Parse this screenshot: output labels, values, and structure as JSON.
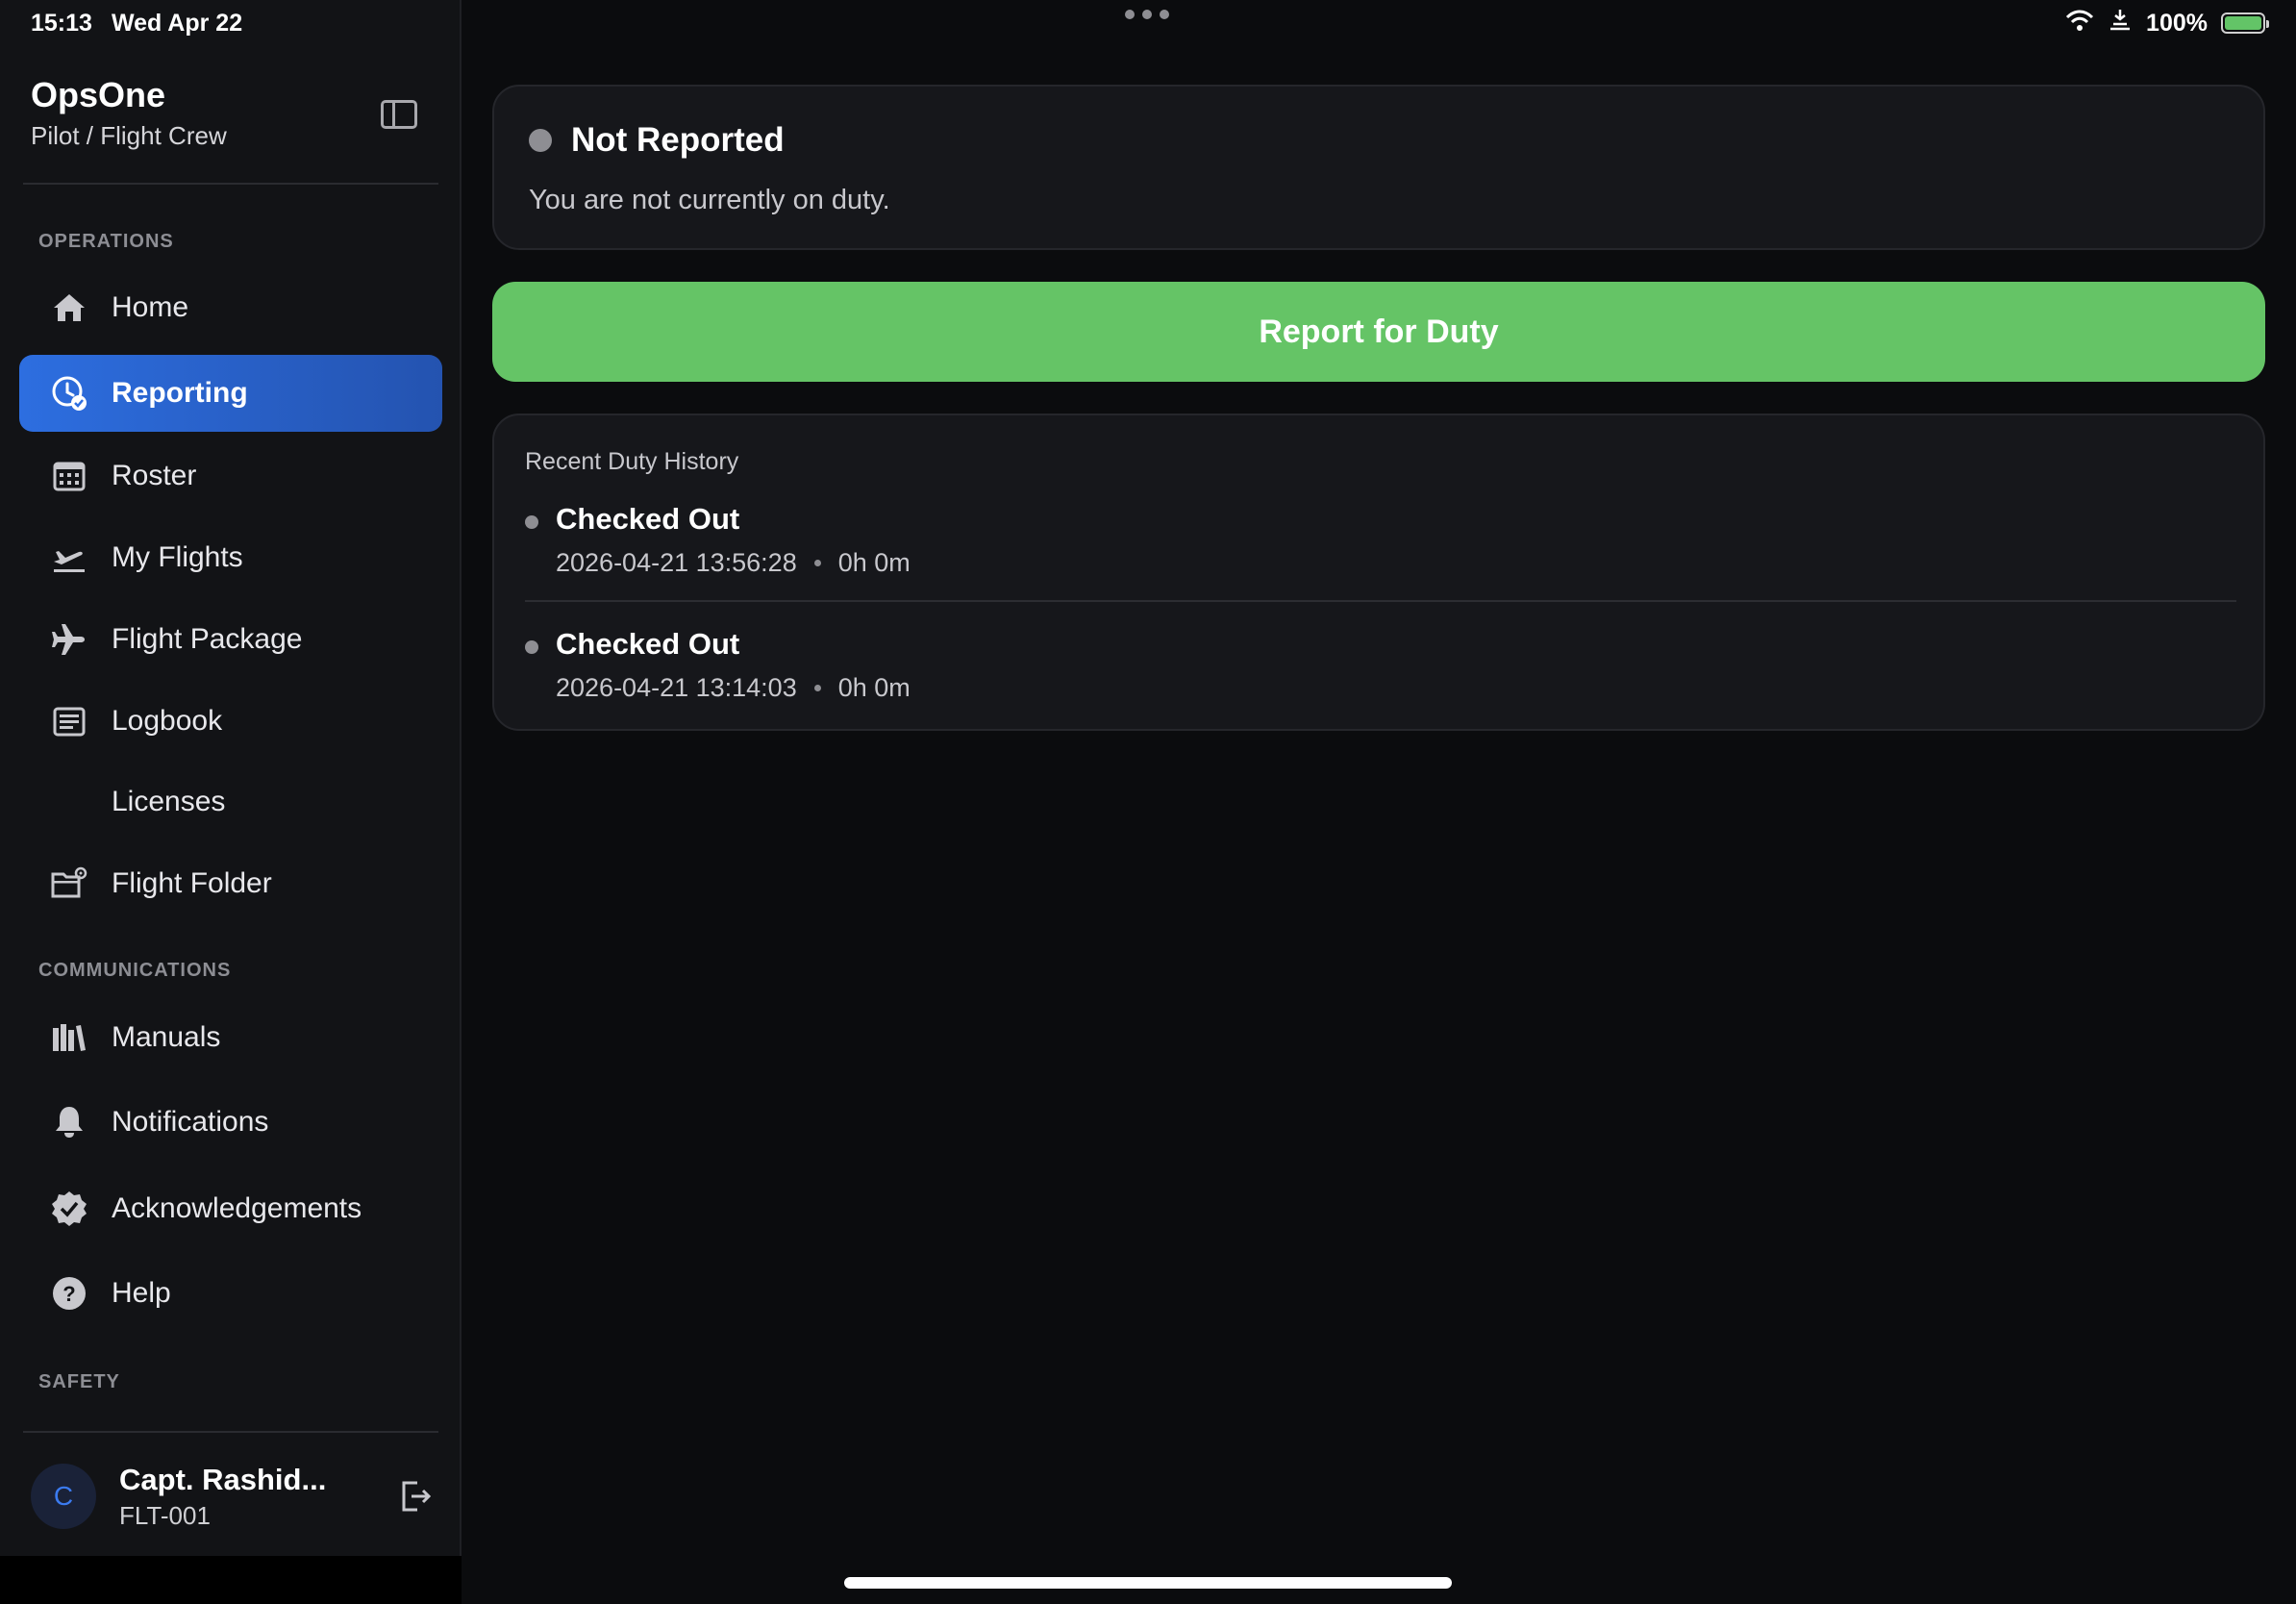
{
  "statusbar": {
    "time": "15:13",
    "date": "Wed Apr 22",
    "battery": "100%"
  },
  "sidebar": {
    "app_title": "OpsOne",
    "app_subtitle": "Pilot / Flight Crew",
    "sections": {
      "operations": "OPERATIONS",
      "communications": "COMMUNICATIONS",
      "safety": "SAFETY"
    },
    "items": [
      {
        "label": "Home",
        "icon": "home-icon"
      },
      {
        "label": "Reporting",
        "icon": "clock-check-icon",
        "active": true
      },
      {
        "label": "Roster",
        "icon": "calendar-icon"
      },
      {
        "label": "My Flights",
        "icon": "airplane-departure-icon"
      },
      {
        "label": "Flight Package",
        "icon": "airplane-icon"
      },
      {
        "label": "Logbook",
        "icon": "logbook-icon"
      },
      {
        "label": "Licenses",
        "icon": ""
      },
      {
        "label": "Flight Folder",
        "icon": "folder-gear-icon"
      },
      {
        "label": "Manuals",
        "icon": "books-icon"
      },
      {
        "label": "Notifications",
        "icon": "bell-icon"
      },
      {
        "label": "Acknowledgements",
        "icon": "checkmark-seal-icon"
      },
      {
        "label": "Help",
        "icon": "question-circle-icon"
      }
    ],
    "user": {
      "initial": "C",
      "name": "Capt. Rashid...",
      "id": "FLT-001"
    }
  },
  "main": {
    "status": {
      "title": "Not Reported",
      "subtitle": "You are not currently on duty."
    },
    "report_button": "Report for Duty",
    "history": {
      "title": "Recent Duty History",
      "items": [
        {
          "status": "Checked Out",
          "timestamp": "2026-04-21 13:56:28",
          "duration": "0h 0m"
        },
        {
          "status": "Checked Out",
          "timestamp": "2026-04-21 13:14:03",
          "duration": "0h 0m"
        }
      ]
    }
  },
  "colors": {
    "accent": "#2d6ee0",
    "report_green": "#65c466",
    "status_gray": "#8e8e93"
  }
}
